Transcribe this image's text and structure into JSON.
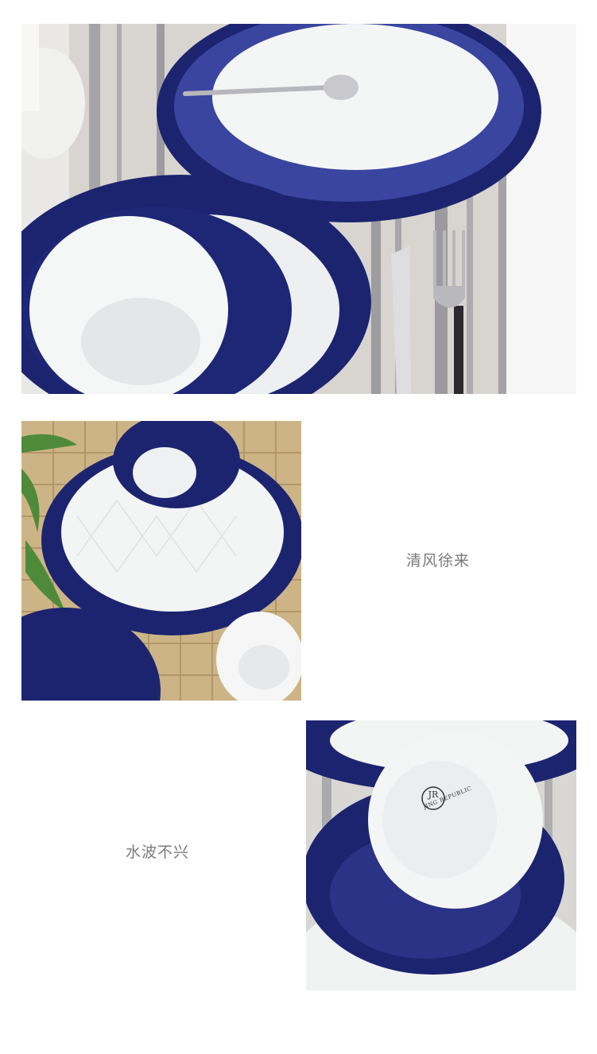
{
  "captions": {
    "first": "清风徐来",
    "second": "水波不兴"
  },
  "photos": {
    "top": {
      "subject": "tableware-set-overview"
    },
    "middle": {
      "subject": "plates-and-bowl-on-jute-mat"
    },
    "bottom": {
      "subject": "inverted-bowl-showing-brand-stamp"
    }
  },
  "brand_stamp": {
    "monogram": "JR",
    "text": "JING REPUBLIC"
  },
  "colors": {
    "cobalt": "#1c2470",
    "porcelain": "#f2f3f2",
    "linen": "#d9d6d2",
    "jute": "#c9b083",
    "caption": "#7a7a7a"
  }
}
